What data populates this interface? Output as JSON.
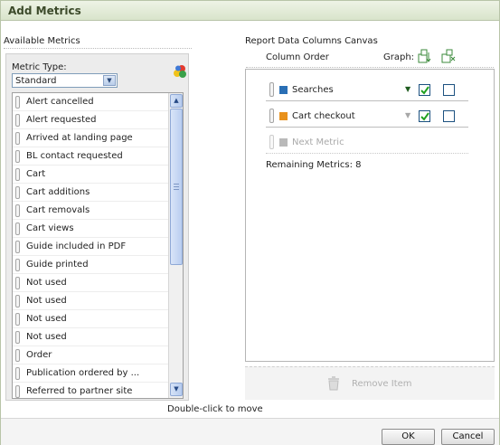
{
  "dialog": {
    "title": "Add Metrics"
  },
  "available": {
    "heading": "Available Metrics",
    "metric_type_label": "Metric Type:",
    "metric_type_value": "Standard",
    "items": [
      "Alert cancelled",
      "Alert requested",
      "Arrived at landing page",
      "BL contact requested",
      "Cart",
      "Cart additions",
      "Cart removals",
      "Cart views",
      "Guide included in PDF",
      "Guide printed",
      "Not used",
      "Not used",
      "Not used",
      "Not used",
      "Order",
      "Publication ordered by ...",
      "Referred to partner site"
    ]
  },
  "canvas": {
    "heading": "Report Data Columns Canvas",
    "column_order_label": "Column Order",
    "graph_label": "Graph:",
    "rows": [
      {
        "label": "Searches",
        "color": "#2a6fb5",
        "arrow": "▼",
        "arrow_color": "#1f5c1f",
        "graph_checked": true,
        "second_checked": false
      },
      {
        "label": "Cart checkout",
        "color": "#e8911c",
        "arrow": "▼",
        "arrow_color": "#a7a7a7",
        "graph_checked": true,
        "second_checked": false
      }
    ],
    "next_metric_label": "Next Metric",
    "remaining_label": "Remaining Metrics: 8",
    "remove_item_label": "Remove Item"
  },
  "hint": "Double-click to move",
  "footer": {
    "ok_label": "OK",
    "cancel_label": "Cancel"
  }
}
